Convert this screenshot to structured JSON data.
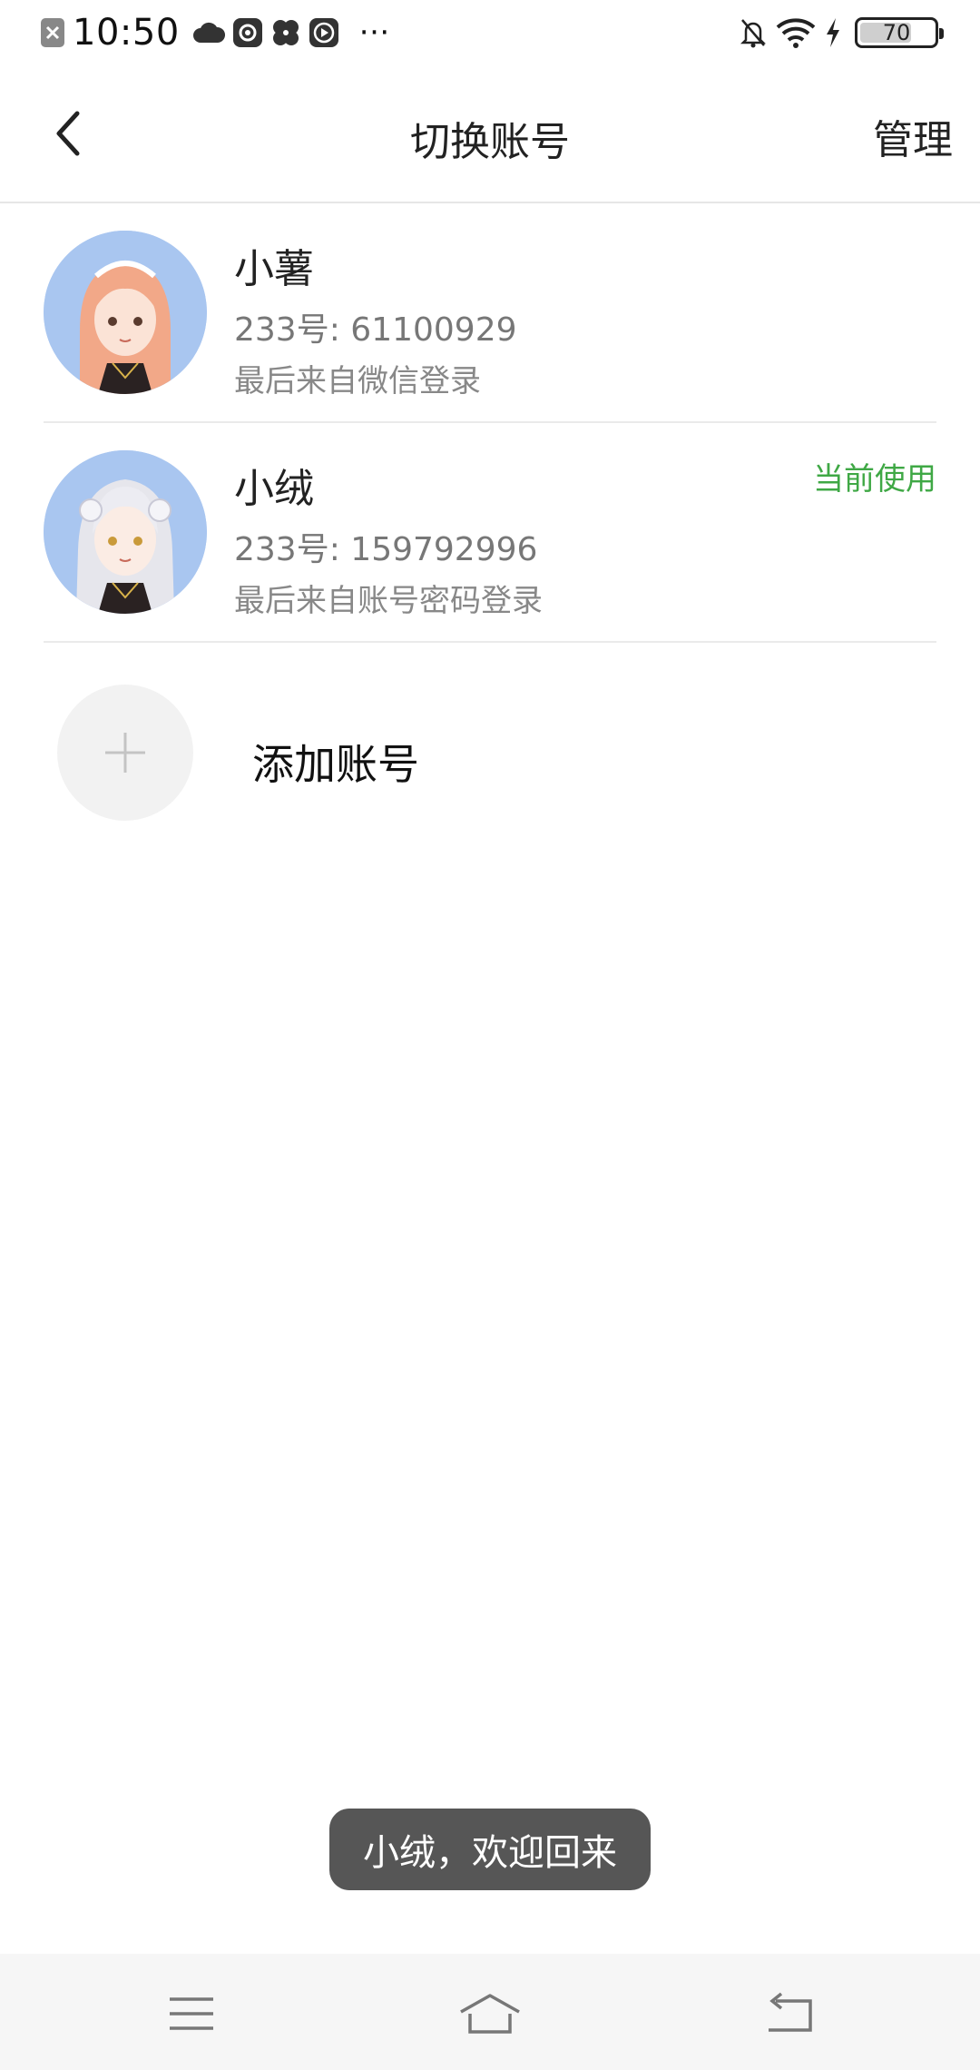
{
  "status_bar": {
    "time": "10:50",
    "more": "···",
    "battery": "70",
    "battery_level": 0.7,
    "left_icons": [
      "close-app-icon",
      "cloud-icon",
      "at-app-icon",
      "fan-app-icon",
      "play-app-icon"
    ],
    "right_icons": [
      "bell-off-icon",
      "wifi-icon",
      "charging-icon",
      "battery-icon"
    ]
  },
  "header": {
    "title": "切换账号",
    "manage_label": "管理"
  },
  "accounts": [
    {
      "name": "小薯",
      "id_text": "233号: 61100929",
      "login_text": "最后来自微信登录",
      "badge": "",
      "hair_color": "#f2a888"
    },
    {
      "name": "小绒",
      "id_text": "233号: 159792996",
      "login_text": "最后来自账号密码登录",
      "badge": "当前使用",
      "hair_color": "#e6e6ec"
    }
  ],
  "add_account": {
    "label": "添加账号"
  },
  "toast": {
    "text": "小绒，欢迎回来"
  },
  "colors": {
    "accent_green": "#3fa845",
    "avatar_bg": "#a9c6f0",
    "toast_bg": "#565656"
  }
}
